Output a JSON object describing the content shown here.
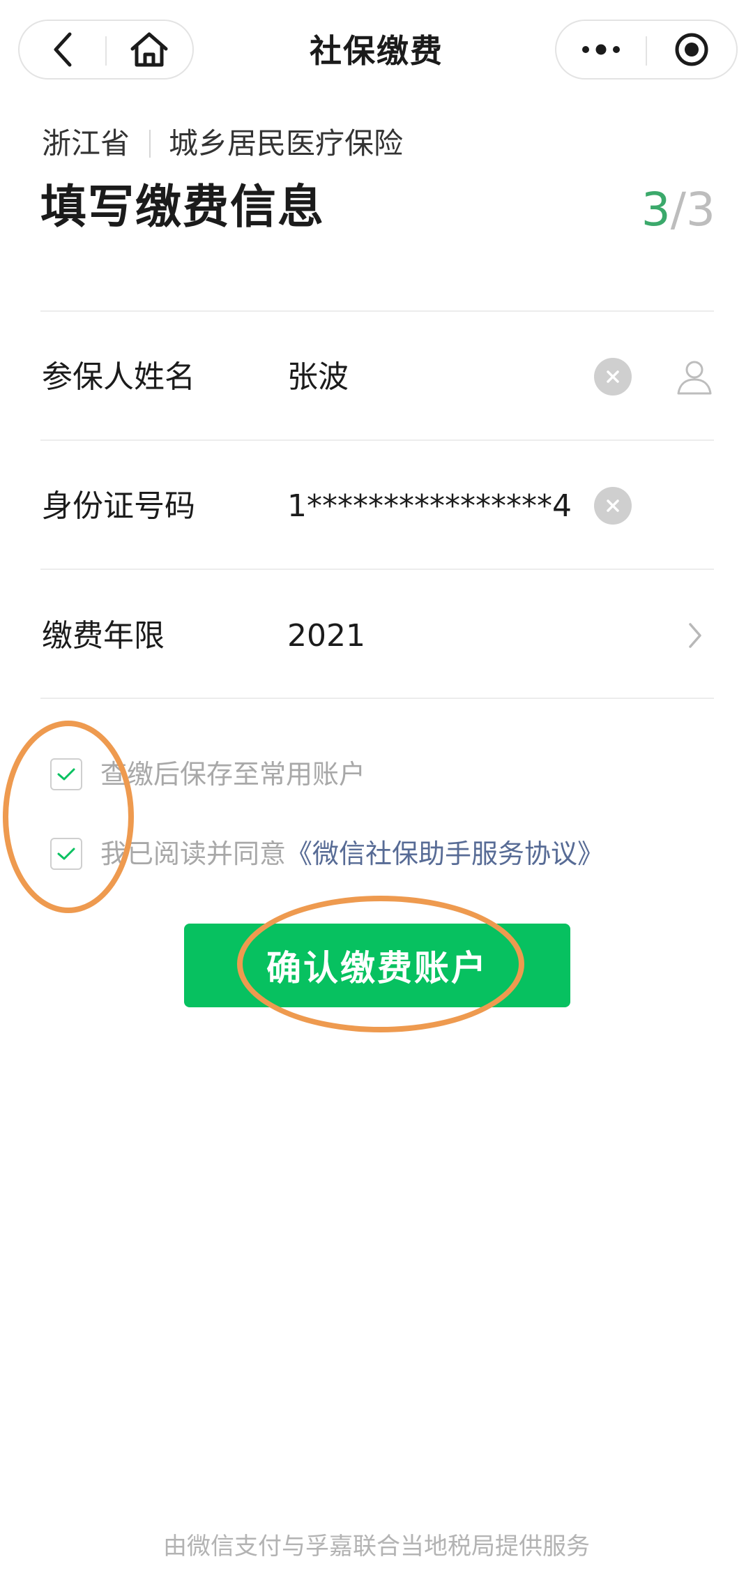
{
  "nav": {
    "title": "社保缴费",
    "back_icon": "back-arrow-icon",
    "home_icon": "home-icon",
    "more_icon": "more-dots-icon",
    "close_icon": "miniprogram-close-icon"
  },
  "header": {
    "province": "浙江省",
    "insurance_type": "城乡居民医疗保险",
    "title": "填写缴费信息",
    "step_current": "3",
    "step_separator": "/",
    "step_total": "3"
  },
  "form": {
    "name": {
      "label": "参保人姓名",
      "value": "张波"
    },
    "id_number": {
      "label": "身份证号码",
      "value": "1****************4"
    },
    "year": {
      "label": "缴费年限",
      "value": "2021"
    }
  },
  "agreements": {
    "save_account": {
      "text": "查缴后保存至常用账户",
      "checked": true
    },
    "agree": {
      "text": "我已阅读并同意",
      "link": "《微信社保助手服务协议》",
      "checked": true
    }
  },
  "confirm_button": "确认缴费账户",
  "footer": "由微信支付与孚嘉联合当地税局提供服务",
  "colors": {
    "brand_green": "#07c160",
    "step_green": "#3ba96b",
    "link_blue": "#576b95",
    "annotation_orange": "#ee9a4f"
  }
}
